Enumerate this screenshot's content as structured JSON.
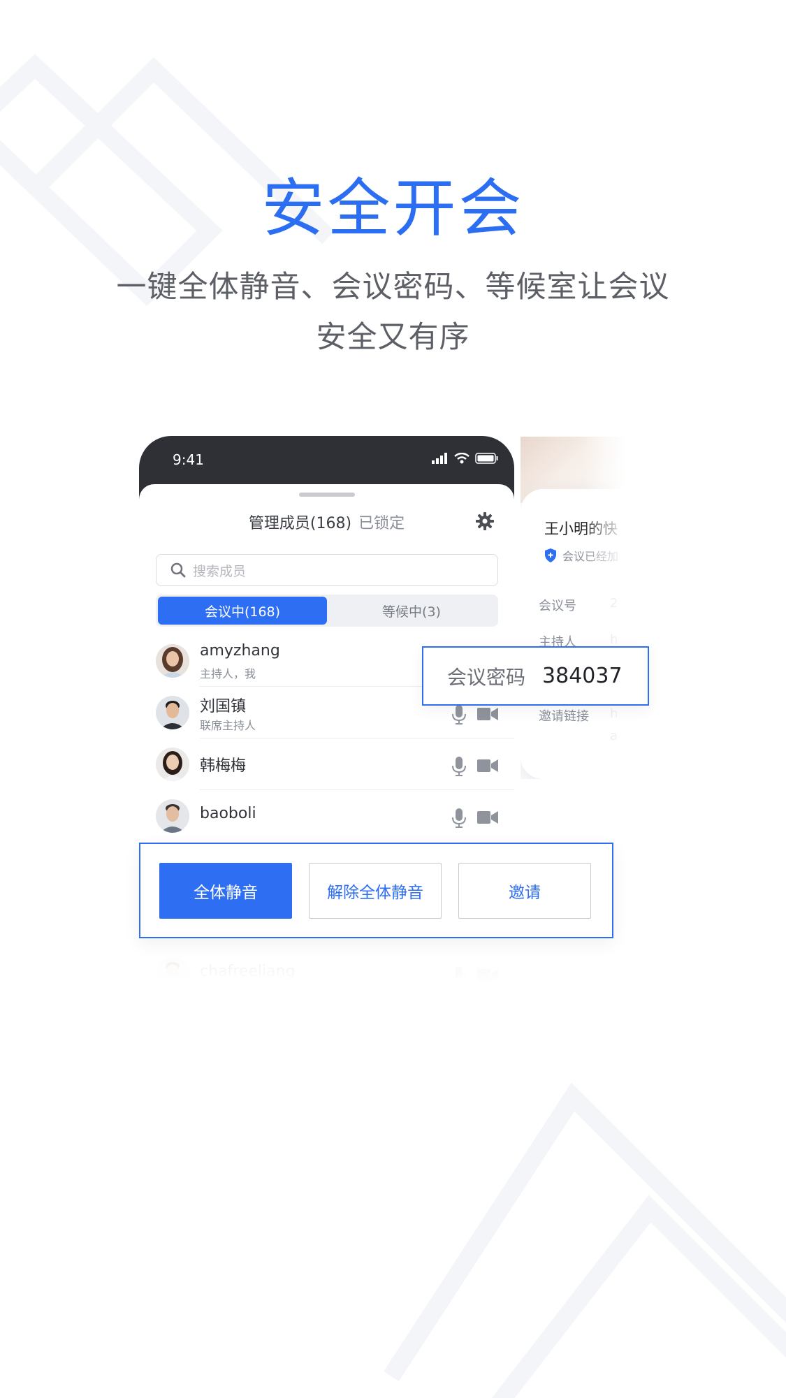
{
  "headline": "安全开会",
  "subline": [
    "一键全体静音、会议密码、等候室让会议",
    "安全又有序"
  ],
  "status_bar": {
    "time": "9:41"
  },
  "sheet": {
    "title": "管理成员(168)",
    "locked": "已锁定",
    "search_placeholder": "搜索成员",
    "tabs": [
      "会议中(168)",
      "等候中(3)"
    ],
    "active_tab": 0
  },
  "members": [
    {
      "name": "amyzhang",
      "role": "主持人，我"
    },
    {
      "name": "刘国镇",
      "role": "联席主持人"
    },
    {
      "name": "韩梅梅",
      "role": ""
    },
    {
      "name": "baoboli",
      "role": ""
    },
    {
      "name": "chafreeliang",
      "role": ""
    }
  ],
  "back_card": {
    "title": "王小明的快",
    "badge": "会议已经加",
    "rows": [
      {
        "label": "会议号",
        "value": "2"
      },
      {
        "label": "主持人",
        "value": "h"
      },
      {
        "label": "邀请链接",
        "value": "h"
      },
      {
        "label": "",
        "value": "a"
      }
    ]
  },
  "password": {
    "label": "会议密码",
    "value": "384037"
  },
  "actions": {
    "mute_all": "全体静音",
    "unmute_all": "解除全体静音",
    "invite": "邀请"
  },
  "colors": {
    "accent": "#2e6ef2",
    "headline": "#2b6ef2"
  }
}
